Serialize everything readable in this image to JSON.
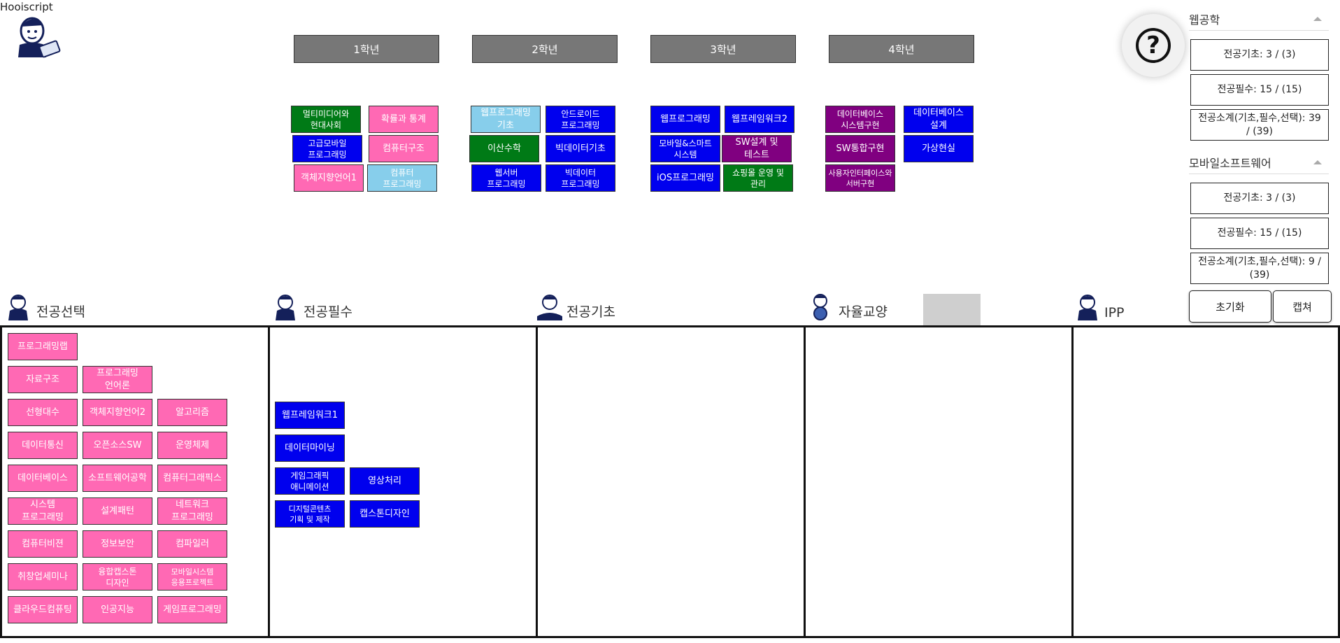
{
  "topleft_text": "Hooiscript",
  "years": [
    "1학년",
    "2학년",
    "3학년",
    "4학년"
  ],
  "year1": [
    "멀티미디어와\n현대사회",
    "확률과 통계",
    "고급모바일\n프로그래밍",
    "컴퓨터구조",
    "객체지향언어1",
    "컴퓨터\n프로그래밍"
  ],
  "year2": [
    "웹프로그래밍\n기초",
    "안드로이드\n프로그래밍",
    "이산수학",
    "빅데이터기초",
    "웹서버\n프로그래밍",
    "빅데이터\n프로그래밍"
  ],
  "year3": [
    "웹프로그래밍",
    "웹프레임워크2",
    "모바일&스마트\n시스템",
    "SW설계 및\n테스트",
    "iOS프로그래밍",
    "쇼핑몰 운영 및\n관리"
  ],
  "year4": [
    "데이터베이스\n시스템구현",
    "데이터베이스\n설계",
    "SW통합구현",
    "가상현실",
    "사용자인터페이스와\n서버구현"
  ],
  "sidebar": {
    "tracks": [
      {
        "name": "웹공학",
        "stats": [
          "전공기초: 3 / (3)",
          "전공필수: 15 / (15)",
          "전공소계(기초,필수,선택): 39 / (39)"
        ]
      },
      {
        "name": "모바일소프트웨어",
        "stats": [
          "전공기초: 3 / (3)",
          "전공필수: 15 / (15)",
          "전공소계(기초,필수,선택): 9 / (39)"
        ]
      }
    ],
    "reset_label": "초기화",
    "capture_label": "캡쳐"
  },
  "zones": [
    "전공선택",
    "전공필수",
    "전공기초",
    "자율교양",
    "IPP"
  ],
  "elective": [
    "프로그래밍랩",
    "자료구조",
    "프로그래밍\n언어론",
    "선형대수",
    "객체지향언어2",
    "알고리즘",
    "데이터통신",
    "오픈소스SW",
    "운영체제",
    "데이터베이스",
    "소프트웨어공학",
    "컴퓨터그래픽스",
    "시스템\n프로그래밍",
    "설계패턴",
    "네트워크\n프로그래밍",
    "컴퓨터비젼",
    "정보보안",
    "컴파일러",
    "취창업세미나",
    "융합캡스톤\n디자인",
    "모바일시스템\n응용프로젝트",
    "클라우드컴퓨팅",
    "인공지능",
    "게임프로그래밍"
  ],
  "required": [
    "웹프레임워크1",
    "데이터마이닝",
    "게임그래픽\n애니메이션",
    "영상처리",
    "디지털콘텐츠\n기획 및 제작",
    "캡스톤디자인"
  ],
  "colors": {
    "blue": "#0000ee",
    "green": "#007a16",
    "pink": "#ff69b4",
    "sky": "#87ceeb",
    "purple": "#800080",
    "header_grey": "#777777"
  }
}
